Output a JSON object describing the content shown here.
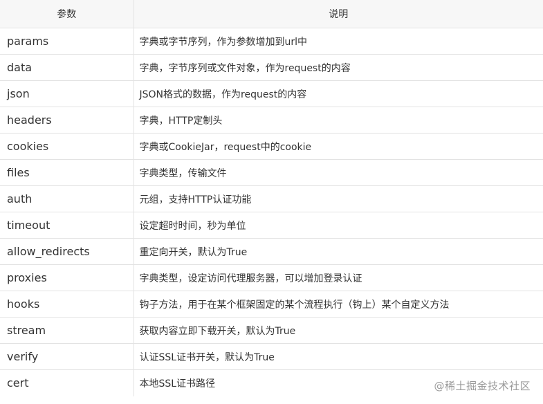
{
  "table": {
    "headers": [
      "参数",
      "说明"
    ],
    "rows": [
      {
        "param": "params",
        "desc": "字典或字节序列，作为参数增加到url中"
      },
      {
        "param": "data",
        "desc": "字典，字节序列或文件对象，作为request的内容"
      },
      {
        "param": "json",
        "desc": "JSON格式的数据，作为request的内容"
      },
      {
        "param": "headers",
        "desc": "字典，HTTP定制头"
      },
      {
        "param": "cookies",
        "desc": "字典或CookieJar，request中的cookie"
      },
      {
        "param": "files",
        "desc": "字典类型，传输文件"
      },
      {
        "param": "auth",
        "desc": "元组，支持HTTP认证功能"
      },
      {
        "param": "timeout",
        "desc": "设定超时时间，秒为单位"
      },
      {
        "param": "allow_redirects",
        "desc": "重定向开关，默认为True"
      },
      {
        "param": "proxies",
        "desc": "字典类型，设定访问代理服务器，可以增加登录认证"
      },
      {
        "param": "hooks",
        "desc": "钩子方法，用于在某个框架固定的某个流程执行（钩上）某个自定义方法"
      },
      {
        "param": "stream",
        "desc": "获取内容立即下载开关，默认为True"
      },
      {
        "param": "verify",
        "desc": "认证SSL证书开关，默认为True"
      },
      {
        "param": "cert",
        "desc": "本地SSL证书路径"
      }
    ]
  },
  "watermark": "@稀土掘金技术社区"
}
